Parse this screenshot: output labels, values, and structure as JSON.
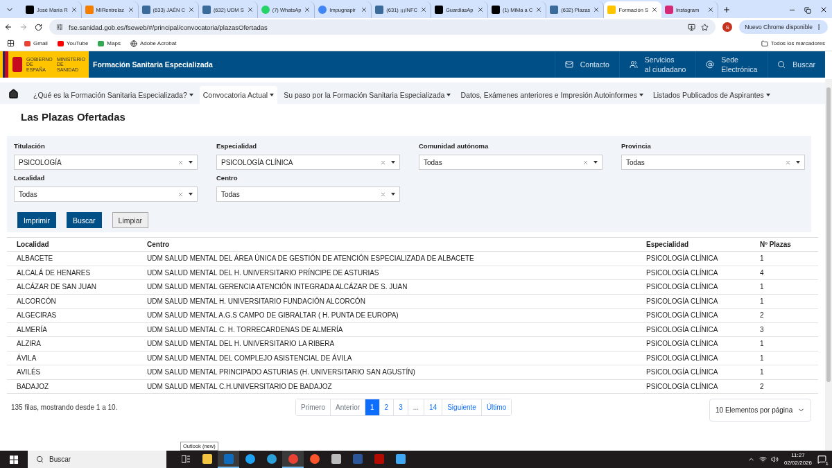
{
  "browser": {
    "tabs": [
      {
        "title": "José María R",
        "kind": "x",
        "selected": false
      },
      {
        "title": "MIRentrelaz",
        "kind": "blogger",
        "selected": false
      },
      {
        "title": "(633) JAÉN C",
        "kind": "forum",
        "selected": false
      },
      {
        "title": "(632) UDM S",
        "kind": "forum",
        "selected": false
      },
      {
        "title": "(7) WhatsAp",
        "kind": "whatsapp",
        "selected": false
      },
      {
        "title": "Impugnapir",
        "kind": "google",
        "selected": false
      },
      {
        "title": "(631) ¡¡¡INFC",
        "kind": "forum",
        "selected": false
      },
      {
        "title": "GuardiasAp",
        "kind": "x",
        "selected": false
      },
      {
        "title": "(1) MiMa a C",
        "kind": "x",
        "selected": false
      },
      {
        "title": "(632) Plazas",
        "kind": "forum",
        "selected": false
      },
      {
        "title": "Formación S",
        "kind": "gov",
        "selected": true
      },
      {
        "title": "Instagram",
        "kind": "instagram",
        "selected": false
      }
    ],
    "url": "fse.sanidad.gob.es/fseweb/#/principal/convocatoria/plazasOfertadas",
    "profile": "S",
    "update_button": "Nuevo Chrome disponible",
    "bookmarks": [
      {
        "label": "Gmail",
        "kind": "gmail"
      },
      {
        "label": "YouTube",
        "kind": "youtube"
      },
      {
        "label": "Maps",
        "kind": "maps"
      },
      {
        "label": "Adobe Acrobat",
        "kind": "globe"
      }
    ],
    "all_bookmarks": "Todos los marcadores"
  },
  "header": {
    "logo_left": "GOBIERNO DE ESPAÑA",
    "logo_right": "MINISTERIO DE SANIDAD",
    "title": "Formación Sanitaria Especializada",
    "links": [
      {
        "label": "Contacto",
        "kind": "mail"
      },
      {
        "label": "Servicios al ciudadano",
        "kind": "people"
      },
      {
        "label": "Sede Electrónica",
        "kind": "at"
      },
      {
        "label": "Buscar",
        "kind": "search"
      }
    ]
  },
  "nav": [
    {
      "label": "¿Qué es la Formación Sanitaria Especializada?",
      "selected": false
    },
    {
      "label": "Convocatoria Actual",
      "selected": true
    },
    {
      "label": "Su paso por la Formación Sanitaria Especializada",
      "selected": false
    },
    {
      "label": "Datos, Exámenes anteriores e Impresión Autoinformes",
      "selected": false
    },
    {
      "label": "Listados Publicados de Aspirantes",
      "selected": false
    }
  ],
  "page_title": "Las Plazas Ofertadas",
  "filters": [
    {
      "label": "Titulación",
      "value": "PSICOLOGÍA"
    },
    {
      "label": "Especialidad",
      "value": "PSICOLOGÍA CLÍNICA"
    },
    {
      "label": "Comunidad autónoma",
      "value": "Todas"
    },
    {
      "label": "Provincia",
      "value": "Todas"
    },
    {
      "label": "Localidad",
      "value": "Todas"
    },
    {
      "label": "Centro",
      "value": "Todas"
    }
  ],
  "buttons": [
    {
      "label": "Imprimir",
      "kind": "primary"
    },
    {
      "label": "Buscar",
      "kind": "primary"
    },
    {
      "label": "Limpiar",
      "kind": "secondary"
    }
  ],
  "table": {
    "columns": [
      "Localidad",
      "Centro",
      "Especialidad",
      "Nº Plazas"
    ],
    "rows": [
      [
        "ALBACETE",
        "UDM SALUD MENTAL DEL ÁREA ÚNICA DE GESTIÓN DE ATENCIÓN ESPECIALIZADA DE ALBACETE",
        "PSICOLOGÍA CLÍNICA",
        "1"
      ],
      [
        "ALCALÁ DE HENARES",
        "UDM SALUD MENTAL DEL H. UNIVERSITARIO PRÍNCIPE DE ASTURIAS",
        "PSICOLOGÍA CLÍNICA",
        "4"
      ],
      [
        "ALCÁZAR DE SAN JUAN",
        "UDM SALUD MENTAL GERENCIA ATENCIÓN INTEGRADA ALCÁZAR DE S. JUAN",
        "PSICOLOGÍA CLÍNICA",
        "1"
      ],
      [
        "ALCORCÓN",
        "UDM SALUD MENTAL H. UNIVERSITARIO FUNDACIÓN ALCORCÓN",
        "PSICOLOGÍA CLÍNICA",
        "1"
      ],
      [
        "ALGECIRAS",
        "UDM SALUD MENTAL A.G.S CAMPO DE GIBRALTAR ( H. PUNTA DE EUROPA)",
        "PSICOLOGÍA CLÍNICA",
        "2"
      ],
      [
        "ALMERÍA",
        "UDM SALUD MENTAL C. H. TORRECARDENAS DE ALMERÍA",
        "PSICOLOGÍA CLÍNICA",
        "3"
      ],
      [
        "ALZIRA",
        "UDM SALUD MENTAL DEL H. UNIVERSITARIO LA RIBERA",
        "PSICOLOGÍA CLÍNICA",
        "1"
      ],
      [
        "ÁVILA",
        "UDM SALUD MENTAL DEL COMPLEJO ASISTENCIAL DE ÁVILA",
        "PSICOLOGÍA CLÍNICA",
        "1"
      ],
      [
        "AVILÉS",
        "UDM SALUD MENTAL PRINCIPADO ASTURIAS (H. UNIVERSITARIO SAN AGUSTÍN)",
        "PSICOLOGÍA CLÍNICA",
        "1"
      ],
      [
        "BADAJOZ",
        "UDM SALUD MENTAL C.H.UNIVERSITARIO DE BADAJOZ",
        "PSICOLOGÍA CLÍNICA",
        "2"
      ]
    ]
  },
  "summary": "135 filas, mostrando desde 1 a 10.",
  "pagination": [
    {
      "label": "Primero",
      "selected": false,
      "disabled": true
    },
    {
      "label": "Anterior",
      "selected": false,
      "disabled": true
    },
    {
      "label": "1",
      "selected": true,
      "disabled": false
    },
    {
      "label": "2",
      "selected": false,
      "disabled": false
    },
    {
      "label": "3",
      "selected": false,
      "disabled": false
    },
    {
      "label": "...",
      "selected": false,
      "disabled": true
    },
    {
      "label": "14",
      "selected": false,
      "disabled": false
    },
    {
      "label": "Siguiente",
      "selected": false,
      "disabled": false
    },
    {
      "label": "Último",
      "selected": false,
      "disabled": false
    }
  ],
  "page_size": "10 Elementos por página",
  "taskbar": {
    "search": "Buscar",
    "tooltip": "Outlook (new)",
    "apps": [
      {
        "kind": "taskview",
        "selected": false
      },
      {
        "kind": "folder",
        "selected": false
      },
      {
        "kind": "outlook",
        "selected": true
      },
      {
        "kind": "ie",
        "selected": false
      },
      {
        "kind": "edge",
        "selected": false
      },
      {
        "kind": "chrome",
        "selected": true
      },
      {
        "kind": "brave",
        "selected": false
      },
      {
        "kind": "printer",
        "selected": false
      },
      {
        "kind": "word",
        "selected": false
      },
      {
        "kind": "pdf",
        "selected": false
      },
      {
        "kind": "photos",
        "selected": false
      }
    ],
    "time": "11:27",
    "date": "02/02/2026",
    "notifications": "1"
  }
}
